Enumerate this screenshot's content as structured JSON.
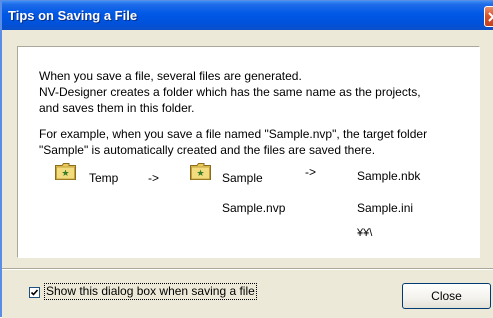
{
  "window": {
    "title": "Tips on Saving a File"
  },
  "message": {
    "line1": "When you save a file, several files are generated.",
    "line2": "NV-Designer creates a folder which has the same name as the projects,",
    "line3": "and saves them in this folder.",
    "line4": "For example, when you save a file named \"Sample.nvp\", the target folder",
    "line5": "\"Sample\" is automatically created and the files are saved there."
  },
  "diagram": {
    "folder_temp": "Temp",
    "arrow1": "->",
    "folder_sample": "Sample",
    "arrow2": "->",
    "file_nvp": "Sample.nvp",
    "file_nbk": "Sample.nbk",
    "file_ini": "Sample.ini",
    "file_more": "¥¥\\"
  },
  "footer": {
    "checkbox_label": "Show this dialog box when saving a file",
    "checkbox_checked": true,
    "close_label": "Close"
  },
  "colors": {
    "titlebar": "#0058e6",
    "dialog_bg": "#ece9d8",
    "panel_bg": "#ffffff"
  },
  "icons": {
    "folder": "folder-icon",
    "window_close": "close-icon",
    "checkmark": "checkmark-icon"
  }
}
